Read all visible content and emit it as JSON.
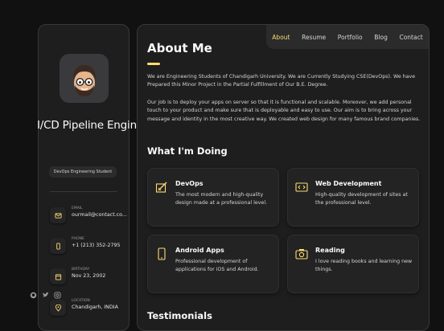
{
  "sidebar": {
    "name": "I/CD Pipeline Enginee",
    "title": "DevOps Engineering Student",
    "contacts": [
      {
        "label": "EMAIL",
        "value": "ourmail@contact.co..."
      },
      {
        "label": "PHONE",
        "value": "+1 (213) 352-2795"
      },
      {
        "label": "BIRTHDAY",
        "value": "Nov 23, 2002"
      },
      {
        "label": "LOCATION",
        "value": "Chandigarh, INDIA"
      }
    ],
    "social_icons": [
      "github-icon",
      "twitter-icon",
      "instagram-icon"
    ]
  },
  "nav": {
    "items": [
      "About",
      "Resume",
      "Portfolio",
      "Blog",
      "Contact"
    ],
    "active": "About"
  },
  "about": {
    "heading": "About Me",
    "paragraph1": "We are Engineering Students of Chandigarh University. We are Currently Studying CSE(DevOps). We have Prepared this Minor Project in the Partial Fulfillment of Our B.E. Degree.",
    "paragraph2": "Our job is to deploy your apps on server so that it is functional and scalable. Moreover, we add personal touch to your product and make sure that is deployable and easy to use. Our aim is to bring across your message and identity in the most creative way. We created web design for many famous brand companies."
  },
  "services": {
    "heading": "What I'm Doing",
    "items": [
      {
        "title": "DevOps",
        "text": "The most modern and high-quality design made at a professional level.",
        "icon": "design-icon"
      },
      {
        "title": "Web Development",
        "text": "High-quality development of sites at the professional level.",
        "icon": "code-icon"
      },
      {
        "title": "Android Apps",
        "text": "Professional development of applications for iOS and Android.",
        "icon": "phone-icon"
      },
      {
        "title": "Reading",
        "text": "I love reading books and learning new things.",
        "icon": "camera-icon"
      }
    ]
  },
  "testimonials": {
    "heading": "Testimonials"
  },
  "colors": {
    "accent": "#ffdb70",
    "background": "#111111",
    "panel": "#1e1e1f"
  }
}
